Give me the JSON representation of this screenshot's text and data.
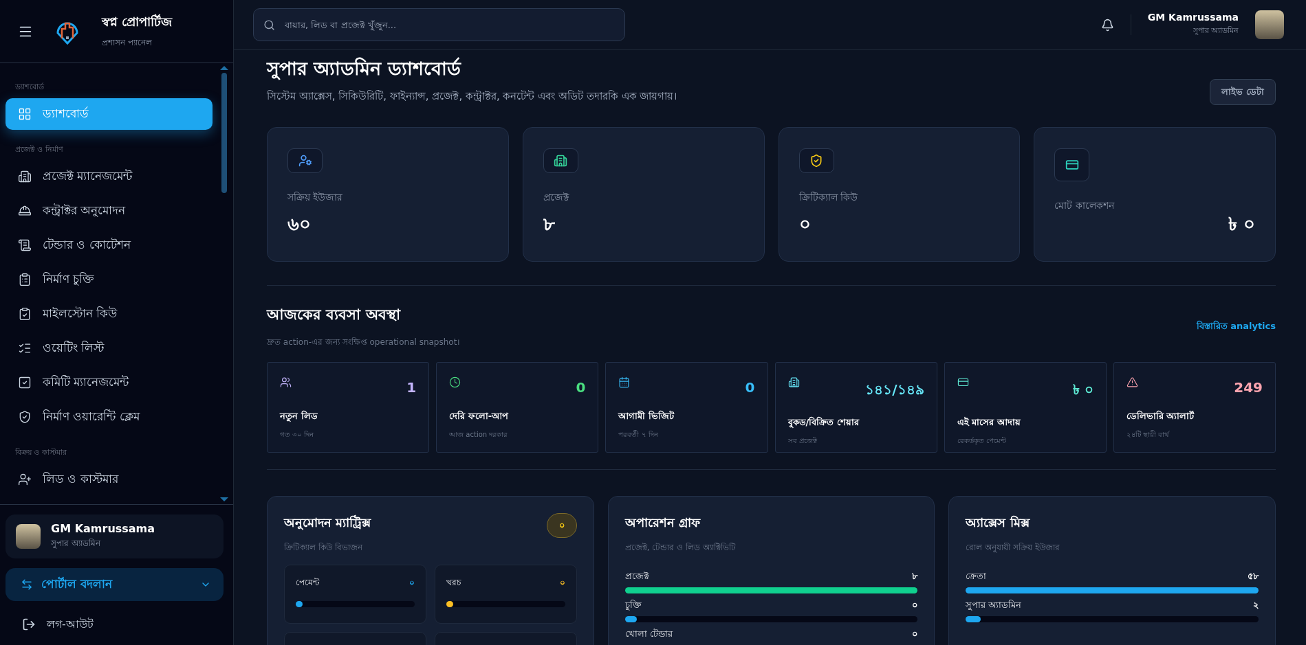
{
  "brand": {
    "name": "স্বপ্ন প্রোপার্টিজ",
    "subtitle": "প্রশাসন প্যানেল"
  },
  "sidebar": {
    "groups": [
      {
        "heading": "ড্যাশবোর্ড",
        "items": [
          {
            "label": "ড্যাশবোর্ড",
            "selected": true
          }
        ]
      },
      {
        "heading": "প্রজেক্ট ও নির্মাণ",
        "items": [
          {
            "label": "প্রজেক্ট ম্যানেজমেন্ট",
            "selected": false
          },
          {
            "label": "কন্ট্রাক্টর অনুমোদন",
            "selected": false
          },
          {
            "label": "টেন্ডার ও কোটেশন",
            "selected": false
          },
          {
            "label": "নির্মাণ চুক্তি",
            "selected": false
          },
          {
            "label": "মাইলস্টোন কিউ",
            "selected": false
          },
          {
            "label": "ওয়েটিং লিস্ট",
            "selected": false
          },
          {
            "label": "কমিটি ম্যানেজমেন্ট",
            "selected": false
          },
          {
            "label": "নির্মাণ ওয়ারেন্টি ক্লেম",
            "selected": false
          }
        ]
      },
      {
        "heading": "বিক্রয় ও কাস্টমার",
        "items": [
          {
            "label": "লিড ও কাস্টমার",
            "selected": false
          }
        ]
      }
    ],
    "user": {
      "name": "GM Kamrussama",
      "role": "সুপার অ্যাডমিন"
    },
    "portal_switch": "পোর্টাল বদলান",
    "logout": "লগ-আউট"
  },
  "header": {
    "search": {
      "placeholder": "বায়ার, লিড বা প্রজেক্ট খুঁজুন..."
    },
    "user": {
      "name": "GM Kamrussama",
      "role": "সুপার অ্যাডমিন"
    }
  },
  "page": {
    "title": "সুপার অ্যাডমিন ড্যাশবোর্ড",
    "subtitle": "সিস্টেম অ্যাক্সেস, সিকিউরিটি, ফাইন্যান্স, প্রজেক্ট, কন্ট্রাক্টর, কনটেন্ট এবং অডিট তদারকি এক জায়গায়।",
    "live_button": "লাইভ ডেটা"
  },
  "stats": [
    {
      "label": "সক্রিয় ইউজার",
      "value": "৬০",
      "color": "#4f9cf9"
    },
    {
      "label": "প্রজেক্ট",
      "value": "৮",
      "color": "#34d399"
    },
    {
      "label": "ক্রিটিক্যাল কিউ",
      "value": "০",
      "color": "#facc15"
    },
    {
      "label": "মোট কালেকশন",
      "value": "৳ ০",
      "color": "#2dd4bf"
    }
  ],
  "snapshot": {
    "title": "আজকের ব্যবসা অবস্থা",
    "subtitle": "দ্রুত action-এর জন্য সংক্ষিপ্ত operational snapshot।",
    "link": "বিস্তারিত analytics",
    "items": [
      {
        "label": "নতুন লিড",
        "note": "গত ৩০ দিন",
        "value": "1",
        "color": "#c4b5fd"
      },
      {
        "label": "দেরি ফলো-আপ",
        "note": "আজ action দরকার",
        "value": "0",
        "color": "#4ade80"
      },
      {
        "label": "আগামী ভিজিট",
        "note": "পরবর্তী ৭ দিন",
        "value": "0",
        "color": "#38bdf8"
      },
      {
        "label": "বুকড/বিক্রিত শেয়ার",
        "note": "সব প্রজেক্ট",
        "value": "১৪১/১৪৯",
        "color": "#67e8f9"
      },
      {
        "label": "এই মাসের আদায়",
        "note": "রেকর্ডকৃত পেমেন্ট",
        "value": "৳ ০",
        "color": "#5eead4"
      },
      {
        "label": "ডেলিভারি অ্যালার্ট",
        "note": "২৪টি স্থায়ী বার্থ",
        "value": "249",
        "color": "#fda4af"
      }
    ]
  },
  "approval_matrix": {
    "title": "অনুমোদন ম্যাট্রিক্স",
    "subtitle": "ক্রিটিক্যাল কিউ বিভাজন",
    "badge": "০",
    "items": [
      {
        "label": "পেমেন্ট",
        "value": "০",
        "level": 0.02,
        "color": "#1ea7f0"
      },
      {
        "label": "খরচ",
        "value": "০",
        "level": 0.02,
        "color": "#fbbf24"
      }
    ]
  },
  "operations": {
    "title": "অপারেশন গ্রাফ",
    "subtitle": "প্রজেক্ট, টেন্ডার ও লিড অ্যাক্টিভিটি",
    "bars": [
      {
        "label": "প্রজেক্ট",
        "value": "৮",
        "level": 1,
        "color": "#10d08f"
      },
      {
        "label": "চুক্তি",
        "value": "০",
        "level": 0.04,
        "color": "#1ea7f0"
      },
      {
        "label": "খোলা টেন্ডার",
        "value": "০"
      }
    ]
  },
  "access_mix": {
    "title": "অ্যাক্সেস মিক্স",
    "subtitle": "রোল অনুযায়ী সক্রিয় ইউজার",
    "bars": [
      {
        "label": "ক্রেতা",
        "value": "৫৮",
        "level": 1,
        "color": "#1ea7f0"
      },
      {
        "label": "সুপার অ্যাডমিন",
        "value": "২",
        "level": 0.05,
        "color": "#1ea7f0"
      }
    ]
  }
}
